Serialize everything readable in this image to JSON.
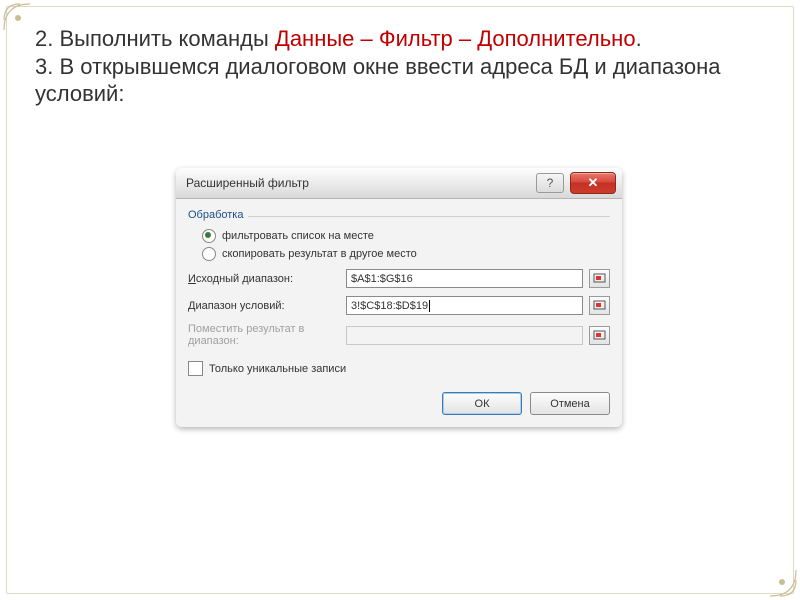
{
  "instructions": {
    "line1_prefix": "2. Выполнить команды ",
    "line1_red": "Данные – Фильтр – Дополнительно",
    "line1_suffix": ".",
    "line2": "3. В открывшемся диалоговом окне ввести адреса БД и диапазона условий:"
  },
  "dialog": {
    "title": "Расширенный фильтр",
    "help_symbol": "?",
    "close_symbol": "✕",
    "group_label": "Обработка",
    "radio1_label": "фильтровать список на месте",
    "radio2_label": "скопировать результат в другое место",
    "source_label": "Исходный диапазон:",
    "source_underline": "И",
    "source_value": "$A$1:$G$16",
    "criteria_label": "Диапазон условий:",
    "criteria_value": "3!$C$18:$D$19",
    "copyto_label": "Поместить результат в диапазон:",
    "unique_label": "Только уникальные записи",
    "ok_label": "ОК",
    "cancel_label": "Отмена"
  },
  "colors": {
    "accent_red": "#c00000",
    "link_blue": "#1a4e8a"
  }
}
